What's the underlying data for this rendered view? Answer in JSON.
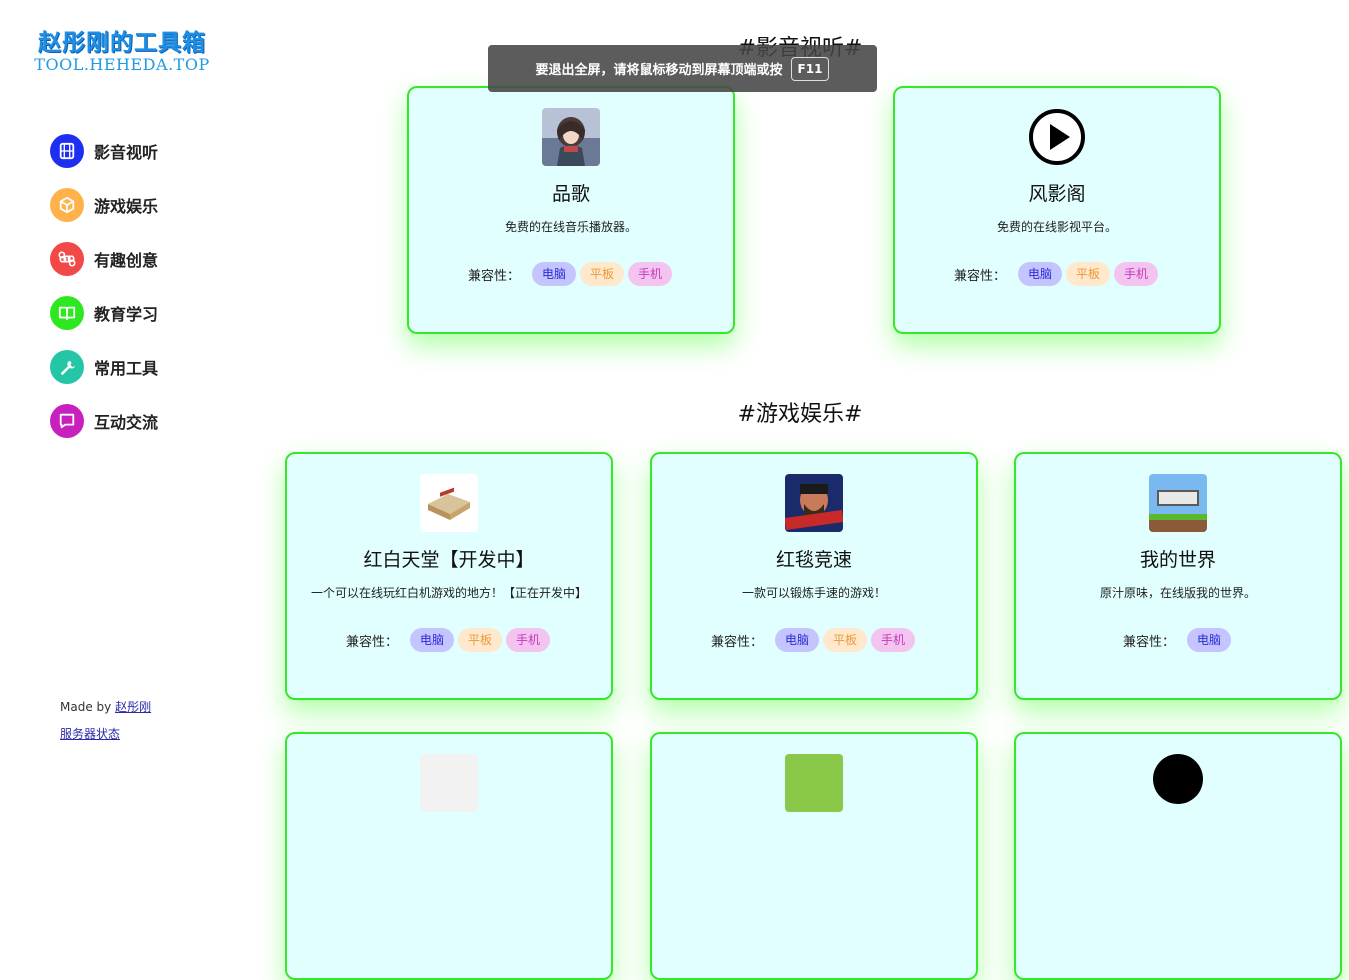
{
  "logo": {
    "title": "赵彤刚的工具箱",
    "subtitle": "TOOL.HEHEDA.TOP"
  },
  "nav": [
    {
      "label": "影音视听",
      "icon": "film-icon",
      "color": "#1f2ff2"
    },
    {
      "label": "游戏娱乐",
      "icon": "cube-icon",
      "color": "#ffb14a"
    },
    {
      "label": "有趣创意",
      "icon": "command-icon",
      "color": "#f24848"
    },
    {
      "label": "教育学习",
      "icon": "book-icon",
      "color": "#2ee81f"
    },
    {
      "label": "常用工具",
      "icon": "wrench-icon",
      "color": "#24c6a6"
    },
    {
      "label": "互动交流",
      "icon": "chat-icon",
      "color": "#c81fbf"
    }
  ],
  "footer": {
    "made_by_prefix": "Made by",
    "author": "赵彤刚",
    "server_status": "服务器状态"
  },
  "toast": {
    "text": "要退出全屏，请将鼠标移动到屏幕顶端或按",
    "key": "F11"
  },
  "compat_label": "兼容性：",
  "tags": {
    "pc": "电脑",
    "pad": "平板",
    "phone": "手机"
  },
  "sections": [
    {
      "title": "#影音视听#",
      "cards": [
        {
          "title": "品歌",
          "desc": "免费的在线音乐播放器。",
          "icon": "anime-girl-icon",
          "tags": [
            "pc",
            "pad",
            "phone"
          ]
        },
        {
          "title": "风影阁",
          "desc": "免费的在线影视平台。",
          "icon": "play-circle-icon",
          "tags": [
            "pc",
            "pad",
            "phone"
          ]
        }
      ]
    },
    {
      "title": "#游戏娱乐#",
      "cards": [
        {
          "title": "红白天堂【开发中】",
          "desc": "一个可以在线玩红白机游戏的地方！【正在开发中】",
          "icon": "famicom-icon",
          "tags": [
            "pc",
            "pad",
            "phone"
          ]
        },
        {
          "title": "红毯竞速",
          "desc": "一款可以锻炼手速的游戏！",
          "icon": "red-carpet-icon",
          "tags": [
            "pc",
            "pad",
            "phone"
          ]
        },
        {
          "title": "我的世界",
          "desc": "原汁原味，在线版我的世界。",
          "icon": "minecraft-icon",
          "tags": [
            "pc"
          ]
        }
      ]
    }
  ]
}
